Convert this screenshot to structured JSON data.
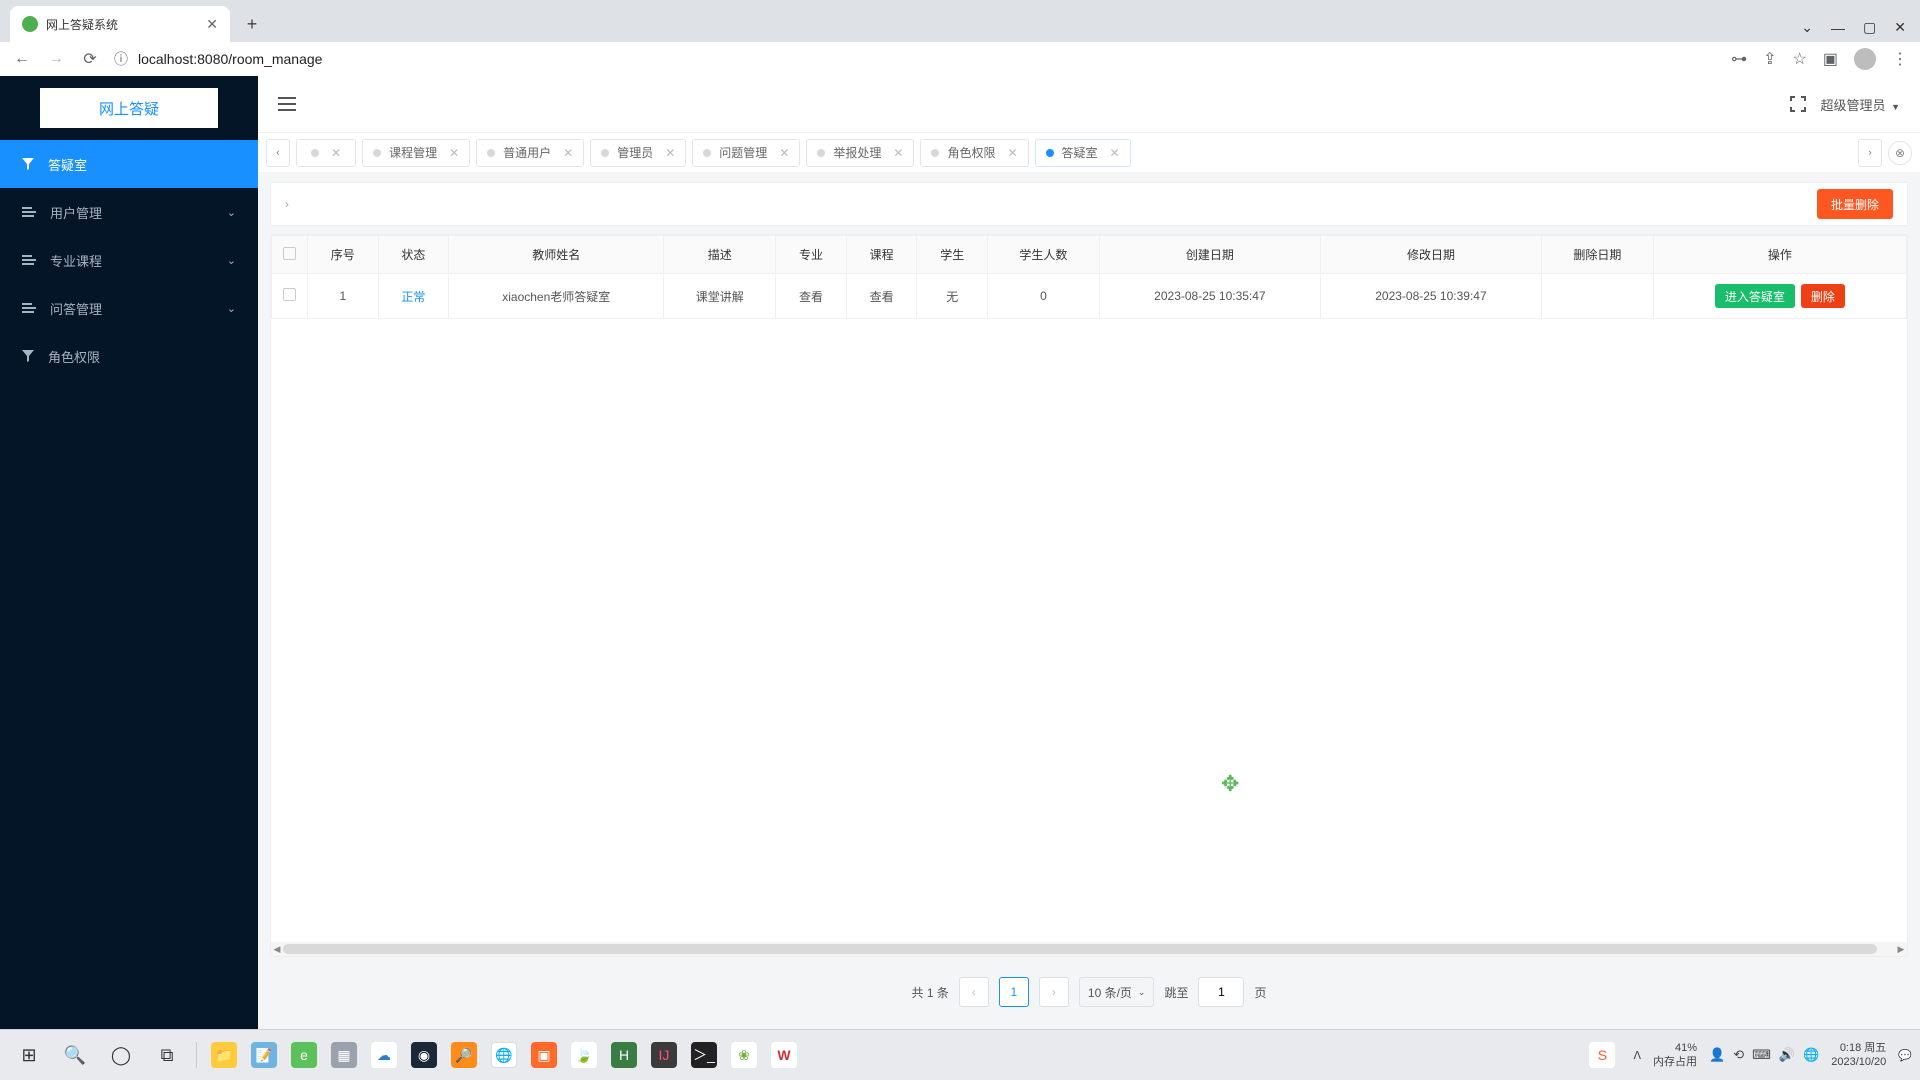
{
  "browser": {
    "tab_title": "网上答疑系统",
    "url_scheme_icon": "ⓘ",
    "url": "localhost:8080/room_manage",
    "window_controls": {
      "chevron": "⌄",
      "min": "—",
      "max": "▢",
      "close": "✕"
    }
  },
  "sidebar": {
    "logo": "网上答疑",
    "items": [
      {
        "label": "答疑室",
        "type": "leaf",
        "active": true
      },
      {
        "label": "用户管理",
        "type": "group"
      },
      {
        "label": "专业课程",
        "type": "group"
      },
      {
        "label": "问答管理",
        "type": "group"
      },
      {
        "label": "角色权限",
        "type": "leaf"
      }
    ]
  },
  "header": {
    "user_label": "超级管理员"
  },
  "page_tabs": {
    "items": [
      {
        "label": "",
        "icon_only": true
      },
      {
        "label": "课程管理"
      },
      {
        "label": "普通用户"
      },
      {
        "label": "管理员"
      },
      {
        "label": "问题管理"
      },
      {
        "label": "举报处理"
      },
      {
        "label": "角色权限"
      },
      {
        "label": "答疑室",
        "active": true
      }
    ]
  },
  "toolbar": {
    "batch_delete": "批量删除"
  },
  "table": {
    "headers": [
      "序号",
      "状态",
      "教师姓名",
      "描述",
      "专业",
      "课程",
      "学生",
      "学生人数",
      "创建日期",
      "修改日期",
      "删除日期",
      "操作"
    ],
    "rows": [
      {
        "no": "1",
        "status": "正常",
        "teacher": "xiaochen老师答疑室",
        "desc": "课堂讲解",
        "major": "查看",
        "course": "查看",
        "student": "无",
        "count": "0",
        "created": "2023-08-25 10:35:47",
        "updated": "2023-08-25 10:39:47",
        "deleted": "",
        "op_enter": "进入答疑室",
        "op_delete": "删除"
      }
    ]
  },
  "pagination": {
    "total_text_prefix": "共",
    "total_text_suffix": "条",
    "total": "1",
    "current": "1",
    "size_label": "10 条/页",
    "jump_label": "跳至",
    "jump_value": "1",
    "jump_suffix": "页"
  },
  "taskbar": {
    "battery_pct": "41%",
    "mem_label": "内存占用",
    "time": "0:18",
    "weekday": "周五",
    "date": "2023/10/20"
  }
}
